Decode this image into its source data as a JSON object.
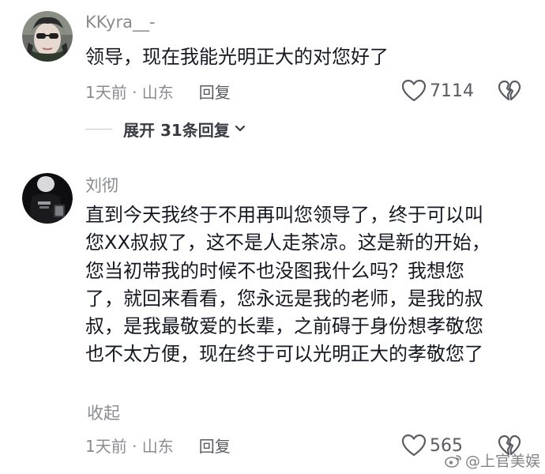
{
  "comments": [
    {
      "username": "KKyra__-",
      "text": "领导，现在我能光明正大的对您好了",
      "time_location": "1天前 · 山东",
      "reply_label": "回复",
      "likes": "7114",
      "expand_label": "展开 31条回复"
    },
    {
      "username": "刘彻",
      "text": "直到今天我终于不用再叫您领导了，终于可以叫\n您XX叔叔了，这不是人走茶凉。这是新的开始，\n您当初带我的时候不也没图我什么吗？我想您\n了，就回来看看，您永远是我的老师，是我的叔\n叔，是我最敬爱的长辈，之前碍于身份想孝敬您\n也不太方便，现在终于可以光明正大的孝敬您了",
      "collapse_label": "收起",
      "time_location": "1天前 · 山东",
      "reply_label": "回复",
      "likes": "565"
    }
  ],
  "watermark": {
    "text": "@上官美娱",
    "icon": "weibo-logo-icon"
  },
  "icons": {
    "like": "heart-outline-icon",
    "dislike": "broken-heart-icon",
    "expand": "chevron-down-icon"
  },
  "colors": {
    "text_primary": "#161823",
    "text_secondary": "#8a8b91",
    "background": "#ffffff"
  }
}
